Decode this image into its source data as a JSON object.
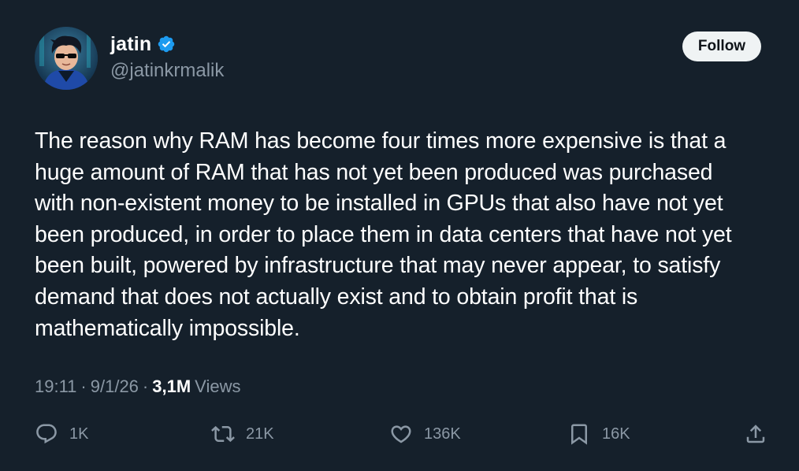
{
  "author": {
    "display_name": "jatin",
    "handle": "@jatinkrmalik",
    "verified": true,
    "avatar_icon": "avatar-icon"
  },
  "follow_button": {
    "label": "Follow"
  },
  "tweet": {
    "text": "The reason why RAM has become four times more expensive is that a\nhuge amount of RAM that has not yet been produced was purchased\nwith non-existent money to be installed in GPUs that also have not yet\nbeen produced, in order to place them in data centers that have not yet\nbeen built, powered by infrastructure that may never appear, to satisfy\ndemand that does not actually exist and to obtain profit that is\nmathematically impossible."
  },
  "meta": {
    "time": "19:11",
    "date": "9/1/26",
    "separator": "·",
    "views_count": "3,1M",
    "views_label": "Views"
  },
  "actions": {
    "replies": "1K",
    "reposts": "21K",
    "likes": "136K",
    "bookmarks": "16K"
  },
  "colors": {
    "background": "#15202b",
    "text": "#ffffff",
    "secondary": "#8b98a5",
    "verified": "#1d9bf0",
    "follow_bg": "#eff3f4"
  }
}
